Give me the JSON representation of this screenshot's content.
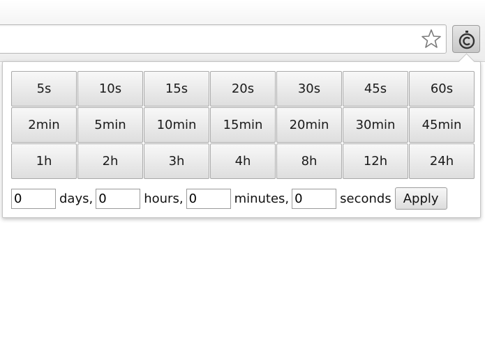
{
  "toolbar": {
    "bookmark_icon": "star-outline-icon",
    "extension_icon": "stopwatch-icon"
  },
  "popup": {
    "presets": [
      [
        "5s",
        "10s",
        "15s",
        "20s",
        "30s",
        "45s",
        "60s"
      ],
      [
        "2min",
        "5min",
        "10min",
        "15min",
        "20min",
        "30min",
        "45min"
      ],
      [
        "1h",
        "2h",
        "3h",
        "4h",
        "8h",
        "12h",
        "24h"
      ]
    ],
    "custom": {
      "days_value": "0",
      "days_label": "days,",
      "hours_value": "0",
      "hours_label": "hours,",
      "minutes_value": "0",
      "minutes_label": "minutes,",
      "seconds_value": "0",
      "seconds_label": "seconds",
      "apply_label": "Apply"
    }
  }
}
